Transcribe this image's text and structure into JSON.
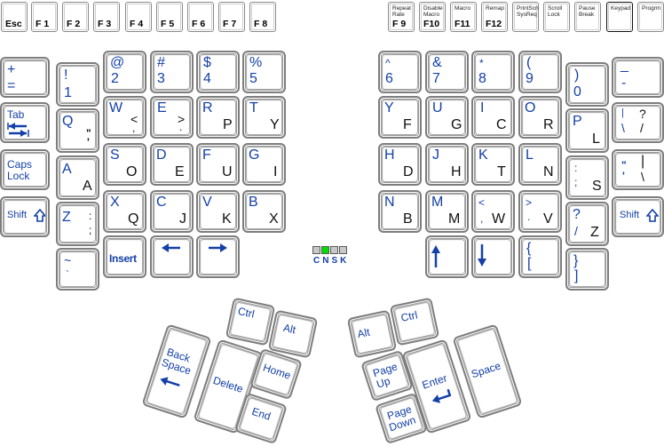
{
  "function_row": {
    "left": [
      {
        "id": "esc",
        "label": "Esc"
      },
      {
        "id": "f1",
        "label": "F 1"
      },
      {
        "id": "f2",
        "label": "F 2"
      },
      {
        "id": "f3",
        "label": "F 3"
      },
      {
        "id": "f4",
        "label": "F 4"
      },
      {
        "id": "f5",
        "label": "F 5"
      },
      {
        "id": "f6",
        "label": "F 6"
      },
      {
        "id": "f7",
        "label": "F 7"
      },
      {
        "id": "f8",
        "label": "F 8"
      }
    ],
    "right": [
      {
        "id": "f9",
        "label": "F 9",
        "sub": "Repeat\nRate"
      },
      {
        "id": "f10",
        "label": "F10",
        "sub": "Disable\nMacro"
      },
      {
        "id": "f11",
        "label": "F11",
        "sub": "Macro"
      },
      {
        "id": "f12",
        "label": "F12",
        "sub": "Remap"
      },
      {
        "id": "printscreen",
        "label": "",
        "sub": "PrintScn\nSysReq"
      },
      {
        "id": "scroll-lock",
        "label": "",
        "sub": "Scroll\nLock"
      },
      {
        "id": "pause",
        "label": "",
        "sub": "Pause\nBreak"
      },
      {
        "id": "keypad",
        "label": "",
        "sub": "Keypad",
        "active": true
      },
      {
        "id": "progrm",
        "label": "",
        "sub": "Progrm"
      }
    ]
  },
  "left_keys": {
    "equals": {
      "top": "+",
      "bottom": "="
    },
    "k1": {
      "top": "!",
      "bottom": "1"
    },
    "k2": {
      "top": "@",
      "bottom": "2"
    },
    "k3": {
      "top": "#",
      "bottom": "3"
    },
    "k4": {
      "top": "$",
      "bottom": "4"
    },
    "k5": {
      "top": "%",
      "bottom": "5"
    },
    "tab": {
      "label": "Tab"
    },
    "q": {
      "main": "Q",
      "alt_top": "\"",
      "alt_bottom": "'"
    },
    "w": {
      "main": "W",
      "alt_top": "<",
      "alt_bottom": ","
    },
    "e": {
      "main": "E",
      "alt_top": ">",
      "alt_bottom": "."
    },
    "r": {
      "main": "R",
      "alt": "P"
    },
    "t": {
      "main": "T",
      "alt": "Y"
    },
    "caps": {
      "line1": "Caps",
      "line2": "Lock"
    },
    "a": {
      "main": "A",
      "alt": "A"
    },
    "s": {
      "main": "S",
      "alt": "O"
    },
    "d": {
      "main": "D",
      "alt": "E"
    },
    "f": {
      "main": "F",
      "alt": "U"
    },
    "g": {
      "main": "G",
      "alt": "I"
    },
    "shift": {
      "label": "Shift"
    },
    "z": {
      "main": "Z",
      "alt_top": ":",
      "alt_bottom": ";"
    },
    "x": {
      "main": "X",
      "alt": "Q"
    },
    "c": {
      "main": "C",
      "alt": "J"
    },
    "v": {
      "main": "V",
      "alt": "K"
    },
    "b": {
      "main": "B",
      "alt": "X"
    },
    "tilde": {
      "top": "~",
      "bottom": "`"
    },
    "insert": {
      "label": "Insert"
    }
  },
  "right_keys": {
    "k6": {
      "top": "^",
      "bottom": "6"
    },
    "k7": {
      "top": "&",
      "bottom": "7"
    },
    "k8": {
      "top": "*",
      "bottom": "8"
    },
    "k9": {
      "top": "(",
      "bottom": "9"
    },
    "k0": {
      "top": ")",
      "bottom": "0"
    },
    "minus": {
      "top": "_",
      "bottom": "-"
    },
    "y": {
      "main": "Y",
      "alt": "F"
    },
    "u": {
      "main": "U",
      "alt": "G"
    },
    "i": {
      "main": "I",
      "alt": "C"
    },
    "o": {
      "main": "O",
      "alt": "R"
    },
    "p": {
      "main": "P",
      "alt": "L"
    },
    "backslash": {
      "top_left": "|",
      "bottom_left": "\\",
      "top_right": "?",
      "bottom_right": "/"
    },
    "h": {
      "main": "H",
      "alt": "D"
    },
    "j": {
      "main": "J",
      "alt": "H"
    },
    "k": {
      "main": "K",
      "alt": "T"
    },
    "l": {
      "main": "L",
      "alt": "N"
    },
    "semicolon": {
      "top": ":",
      "bottom": ";",
      "alt": "S"
    },
    "quote": {
      "top_left": "\"",
      "bottom_left": "'",
      "top_right": "|",
      "bottom_right": "\\"
    },
    "n": {
      "main": "N",
      "alt": "B"
    },
    "m": {
      "main": "M",
      "alt": "M"
    },
    "comma": {
      "top": "<",
      "bottom": ",",
      "alt": "W"
    },
    "period": {
      "top": ">",
      "bottom": ".",
      "alt": "V"
    },
    "slash": {
      "top": "?",
      "bottom": "/",
      "alt": "Z"
    },
    "shift": {
      "label": "Shift"
    },
    "lbracket": {
      "top": "{",
      "bottom": "["
    },
    "rbracket": {
      "top": "}",
      "bottom": "]"
    }
  },
  "indicators": {
    "labels": "CNSK",
    "leds": [
      {
        "name": "caps",
        "on": false
      },
      {
        "name": "num",
        "on": true
      },
      {
        "name": "scroll",
        "on": false
      },
      {
        "name": "keypad",
        "on": false
      }
    ]
  },
  "left_thumb": {
    "ctrl": "Ctrl",
    "alt": "Alt",
    "backspace_line1": "Back",
    "backspace_line2": "Space",
    "delete": "Delete",
    "home": "Home",
    "end": "End"
  },
  "right_thumb": {
    "alt": "Alt",
    "ctrl": "Ctrl",
    "pageup_line1": "Page",
    "pageup_line2": "Up",
    "pagedown_line1": "Page",
    "pagedown_line2": "Down",
    "enter": "Enter",
    "space": "Space"
  },
  "colors": {
    "primary_legend": "#1440a8",
    "secondary_legend": "#111111",
    "led_on": "#00dd00",
    "led_off": "#c8c8c8"
  }
}
